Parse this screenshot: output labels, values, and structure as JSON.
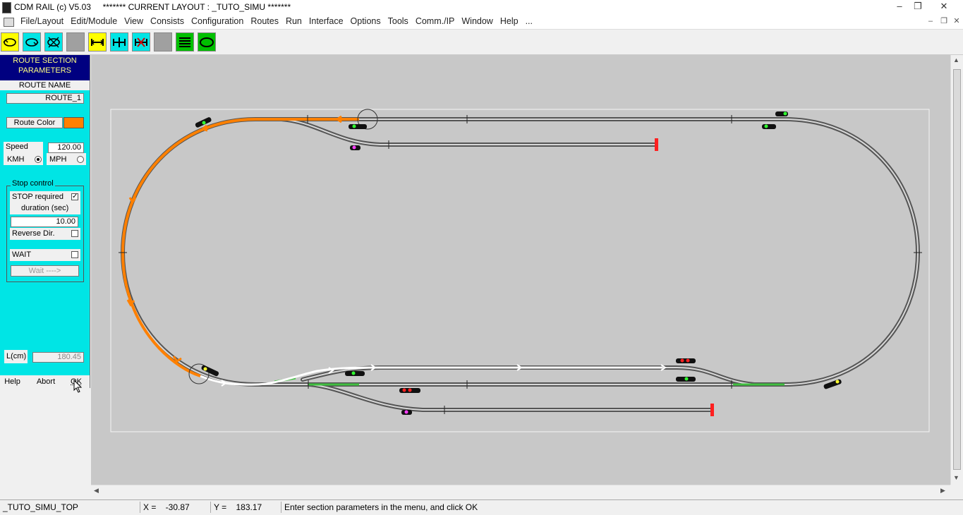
{
  "window": {
    "app_title": "CDM RAIL (c) V5.03",
    "layout_title": "******* CURRENT LAYOUT : _TUTO_SIMU *******",
    "minimize": "–",
    "restore": "❐",
    "close": "✕"
  },
  "menu": {
    "items": [
      "File/Layout",
      "Edit/Module",
      "View",
      "Consists",
      "Configuration",
      "Routes",
      "Run",
      "Interface",
      "Options",
      "Tools",
      "Comm./IP",
      "Window",
      "Help",
      "..."
    ]
  },
  "toolbar": {
    "buttons": [
      {
        "icon": "loop-left-icon",
        "bg": "#ffff00"
      },
      {
        "icon": "loop-right-icon",
        "bg": "#00e5e5"
      },
      {
        "icon": "loop-cross-icon",
        "bg": "#00e5e5"
      },
      {
        "icon": "blank-icon",
        "bg": "#a0a0a0"
      },
      {
        "icon": "section-icon",
        "bg": "#ffff00"
      },
      {
        "icon": "section-split-icon",
        "bg": "#00e5e5"
      },
      {
        "icon": "section-cross-icon",
        "bg": "#00e5e5"
      },
      {
        "icon": "blank-icon",
        "bg": "#a0a0a0"
      },
      {
        "icon": "list-icon",
        "bg": "#00c000"
      },
      {
        "icon": "oval-icon",
        "bg": "#00c000"
      }
    ]
  },
  "panel": {
    "header": "ROUTE SECTION PARAMETERS",
    "route_name_label": "ROUTE NAME",
    "route_name_value": "ROUTE_1",
    "route_color_label": "Route Color",
    "route_color": "#ff8000",
    "speed_label": "Speed",
    "speed_value": "120.00",
    "kmh_label": "KMH",
    "mph_label": "MPH",
    "stop_group_label": "Stop control",
    "stop_required_label": "STOP required",
    "duration_label": "duration (sec)",
    "duration_value": "10.00",
    "reverse_label": "Reverse Dir.",
    "wait_label": "WAIT",
    "wait_button": "Wait ---->",
    "length_label": "L(cm)",
    "length_value": "180.45",
    "help_button": "Help",
    "abort_button": "Abort",
    "ok_button": "OK"
  },
  "status": {
    "layout": "_TUTO_SIMU_TOP",
    "x": "X =    -30.87",
    "y": "Y =    183.17",
    "message": "Enter section parameters in the menu, and click OK"
  },
  "colors": {
    "route": "#ff8000",
    "selected_path": "#ffffff",
    "green_section": "#40c040",
    "canvas": "#c8c8c8",
    "panel": "#00e5e5",
    "panel_header": "#000080"
  }
}
